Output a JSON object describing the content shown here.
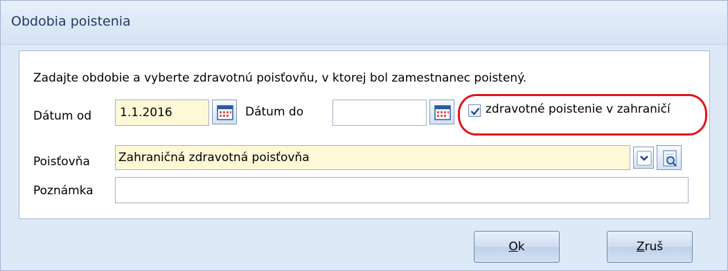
{
  "window": {
    "title": "Obdobia poistenia"
  },
  "form": {
    "instruction": "Zadajte obdobie a vyberte zdravotnú poisťovňu, v ktorej bol zamestnanec poistený.",
    "date_from_label": "Dátum od",
    "date_from_value": "1.1.2016",
    "date_to_label": "Dátum do",
    "date_to_value": "",
    "abroad_checkbox_label": "zdravotné poistenie v zahraničí",
    "abroad_checkbox_checked": true,
    "insurer_label": "Poisťovňa",
    "insurer_value": "Zahraničná zdravotná poisťovňa",
    "note_label": "Poznámka",
    "note_value": ""
  },
  "buttons": {
    "ok_mnemonic": "O",
    "ok_rest": "k",
    "cancel_mnemonic": "Z",
    "cancel_rest": "ruš"
  },
  "colors": {
    "highlight": "#e0141c",
    "field_yellow": "#fdf8d6",
    "window_bg": "#dee9f7"
  },
  "icons": {
    "date_picker": "calendar-icon",
    "dropdown": "chevron-down-icon",
    "lookup": "magnifier-icon",
    "checkbox": "checkmark-icon"
  }
}
